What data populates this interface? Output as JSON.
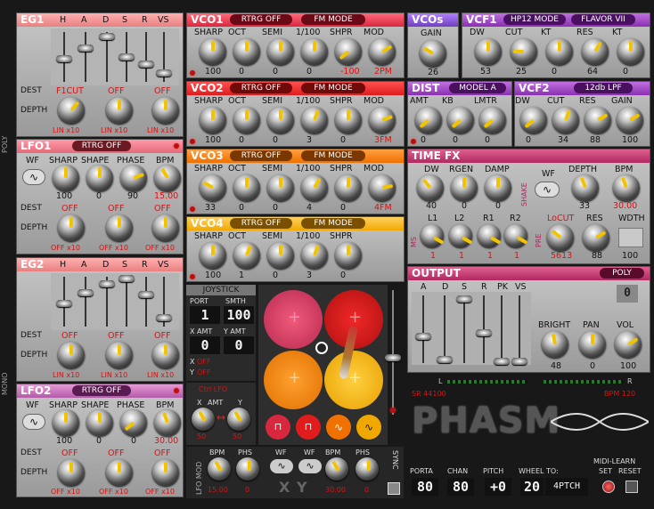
{
  "eg1": {
    "title": "EG1",
    "h": "H",
    "a": "A",
    "d": "D",
    "s": "S",
    "r": "R",
    "vs": "VS",
    "dest": "DEST",
    "depth": "DEPTH",
    "d1": "F1CUT",
    "d2": "OFF",
    "d3": "OFF",
    "m1": "LIN x10",
    "m2": "LIN x10",
    "m3": "LIN x10"
  },
  "poly_label": "POLY",
  "mono_label": "MONO",
  "lfo1": {
    "title": "LFO1",
    "rtrg": "RTRG OFF",
    "wf": "WF",
    "sharp": "SHARP",
    "shape": "SHAPE",
    "phase": "PHASE",
    "bpm": "BPM",
    "v_sharp": "100",
    "v_shape": "0",
    "v_phase": "90",
    "v_bpm": "15.00",
    "dest": "DEST",
    "depth": "DEPTH",
    "d1": "OFF",
    "d2": "OFF",
    "d3": "OFF",
    "m1": "OFF x10",
    "m2": "OFF x10",
    "m3": "OFF x10"
  },
  "eg2": {
    "title": "EG2",
    "h": "H",
    "a": "A",
    "d": "D",
    "s": "S",
    "r": "R",
    "vs": "VS",
    "dest": "DEST",
    "depth": "DEPTH",
    "d1": "OFF",
    "d2": "OFF",
    "d3": "OFF",
    "m1": "LIN x10",
    "m2": "LIN x10",
    "m3": "LIN x10"
  },
  "lfo2": {
    "title": "LFO2",
    "rtrg": "RTRG OFF",
    "wf": "WF",
    "sharp": "SHARP",
    "shape": "SHAPE",
    "phase": "PHASE",
    "bpm": "BPM",
    "v_sharp": "100",
    "v_shape": "0",
    "v_phase": "0",
    "v_bpm": "30.00",
    "dest": "DEST",
    "depth": "DEPTH",
    "d1": "OFF",
    "d2": "OFF",
    "d3": "OFF",
    "m1": "OFF x10",
    "m2": "OFF x10",
    "m3": "OFF x10"
  },
  "vco1": {
    "title": "VCO1",
    "rtrg": "RTRG OFF",
    "fm": "FM MODE",
    "labels": [
      "SHARP",
      "OCT",
      "SEMI",
      "1/100",
      "SHPR",
      "MOD"
    ],
    "values": [
      "100",
      "0",
      "0",
      "0",
      "-100",
      "2PM"
    ]
  },
  "vco2": {
    "title": "VCO2",
    "rtrg": "RTRG OFF",
    "fm": "FM MODE",
    "labels": [
      "SHARP",
      "OCT",
      "SEMI",
      "1/100",
      "SHPR",
      "MOD"
    ],
    "values": [
      "100",
      "0",
      "0",
      "3",
      "0",
      "3FM"
    ]
  },
  "vco3": {
    "title": "VCO3",
    "rtrg": "RTRG OFF",
    "fm": "FM MODE",
    "labels": [
      "SHARP",
      "OCT",
      "SEMI",
      "1/100",
      "SHPR",
      "MOD"
    ],
    "values": [
      "33",
      "0",
      "0",
      "4",
      "0",
      "4FM"
    ]
  },
  "vco4": {
    "title": "VCO4",
    "rtrg": "RTRG OFF",
    "fm": "FM MODE",
    "labels": [
      "SHARP",
      "OCT",
      "SEMI",
      "1/100",
      "SHPR"
    ],
    "values": [
      "100",
      "1",
      "0",
      "3",
      "0"
    ]
  },
  "vcos": {
    "title": "VCOs",
    "gain": "GAIN",
    "v_gain": "26"
  },
  "vcf1": {
    "title": "VCF1",
    "mode": "HP12 MODE",
    "flavor": "FLAVOR VII",
    "labels": [
      "DW",
      "CUT",
      "KT",
      "RES",
      "KT"
    ],
    "values": [
      "53",
      "25",
      "0",
      "64",
      "0"
    ]
  },
  "dist": {
    "title": "DIST",
    "model": "MODEL A",
    "labels": [
      "AMT",
      "KB",
      "LMTR"
    ],
    "values": [
      "0",
      "0",
      "0"
    ]
  },
  "vcf2": {
    "title": "VCF2",
    "mode": "12db LPF",
    "labels": [
      "DW",
      "CUT",
      "RES",
      "GAIN"
    ],
    "values": [
      "0",
      "34",
      "88",
      "100"
    ]
  },
  "timefx": {
    "title": "TIME FX",
    "dw": "DW",
    "rgen": "RGEN",
    "damp": "DAMP",
    "v_dw": "40",
    "v_rgen": "0",
    "v_damp": "0",
    "shake": "SHAKE",
    "wf": "WF",
    "depth": "DEPTH",
    "bpm": "BPM",
    "v_depth": "33",
    "v_bpm": "30.00",
    "ms": "MS",
    "l1": "L1",
    "l2": "L2",
    "r1": "R1",
    "r2": "R2",
    "v_l1": "1",
    "v_l2": "1",
    "v_r1": "1",
    "v_r2": "1",
    "pre": "PRE",
    "locut": "LoCUT",
    "res": "RES",
    "v_locut": "5613",
    "v_res": "88",
    "width": "WDTH",
    "v_width": "100"
  },
  "output": {
    "title": "OUTPUT",
    "poly": "POLY",
    "a": "A",
    "d": "D",
    "s": "S",
    "r": "R",
    "pk": "PK",
    "vs": "VS",
    "voice": "0",
    "bright": "BRIGHT",
    "pan": "PAN",
    "vol": "VOL",
    "v_bright": "48",
    "v_pan": "0",
    "v_vol": "100",
    "l": "L",
    "rr": "R",
    "sr": "SR 44100",
    "bpm": "BPM 120"
  },
  "joystick": {
    "title": "JOYSTICK",
    "port": "PORT",
    "smth": "SMTH",
    "v_port": "1",
    "v_smth": "100",
    "xamt": "X AMT",
    "yamt": "Y AMT",
    "v_xamt": "0",
    "v_yamt": "0",
    "x": "X",
    "y": "Y",
    "xoff": "OFF",
    "yoff": "OFF"
  },
  "lfoxy": {
    "title": "Ctrl LFO",
    "amt": "AMT",
    "x": "X",
    "y": "Y",
    "v_x": "50",
    "v_y": "50"
  },
  "lfomod": {
    "tab": "LFO MOD",
    "bpm": "BPM",
    "phs": "PHS",
    "wf": "WF",
    "vx_bpm": "15.00",
    "vx_phs": "0",
    "vy_bpm": "30.00",
    "vy_phs": "0",
    "x": "X",
    "y": "Y",
    "sync": "SYNC"
  },
  "footer": {
    "porta": "PORTA",
    "chan": "CHAN",
    "pitch": "PITCH",
    "wheel": "WHEEL TO:",
    "midilearn": "MIDI-LEARN",
    "set": "SET",
    "reset": "RESET",
    "v_porta": "80",
    "v_chan": "80",
    "v_pitch": "+0",
    "v_wheel_num": "20",
    "v_wheel": "4PTCH"
  },
  "logo": "PHASM"
}
